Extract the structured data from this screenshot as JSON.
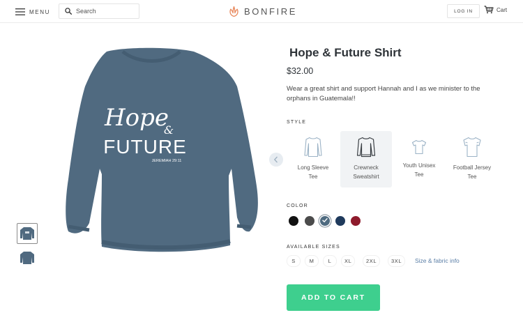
{
  "header": {
    "menu_label": "MENU",
    "search_placeholder": "Search",
    "brand": "BONFIRE",
    "login_label": "LOG IN",
    "cart_label": "Cart"
  },
  "product": {
    "title": "Hope & Future Shirt",
    "price": "$32.00",
    "description": "Wear a great shirt and support Hannah and I as we minister to the orphans in Guatemala!!",
    "print": {
      "line1": "Hope",
      "amp": "&",
      "line2": "FUTURE",
      "verse": "JEREMIAH 29:11"
    },
    "garment_color": "#4f6b80"
  },
  "style": {
    "label": "STYLE",
    "options": [
      {
        "line1": "Long Sleeve",
        "line2": "Tee",
        "selected": false
      },
      {
        "line1": "Crewneck",
        "line2": "Sweatshirt",
        "selected": true
      },
      {
        "line1": "Youth Unisex",
        "line2": "Tee",
        "selected": false
      },
      {
        "line1": "Football Jersey",
        "line2": "Tee",
        "selected": false
      }
    ]
  },
  "color": {
    "label": "COLOR",
    "swatches": [
      "#111111",
      "#4b4b4b",
      "#4f6b80",
      "#1f3a5c",
      "#8e1b2c"
    ],
    "selected_index": 2
  },
  "sizes": {
    "label": "AVAILABLE SIZES",
    "options": [
      "S",
      "M",
      "L",
      "XL",
      "2XL",
      "3XL"
    ],
    "link": "Size & fabric info"
  },
  "cta": {
    "add_to_cart": "ADD TO CART",
    "color": "#3ecf8e"
  },
  "brand_color": "#e8885c"
}
